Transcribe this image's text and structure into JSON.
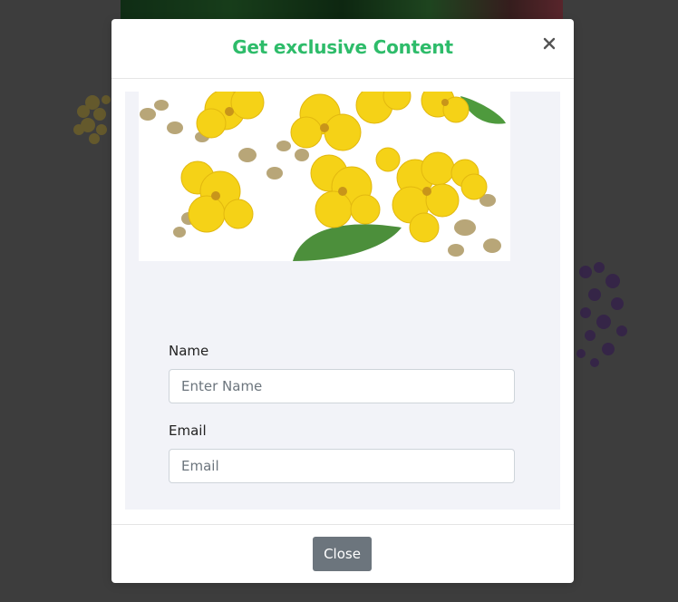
{
  "modal": {
    "title": "Get exclusive Content",
    "close_icon": "close-icon",
    "title_color": "#2ebc6a",
    "image": "yellow-mullein-flowers"
  },
  "form": {
    "name_label": "Name",
    "name_placeholder": "Enter Name",
    "name_value": "",
    "email_label": "Email",
    "email_placeholder": "Email",
    "email_value": ""
  },
  "footer": {
    "close_label": "Close",
    "close_color": "#6c757d"
  }
}
